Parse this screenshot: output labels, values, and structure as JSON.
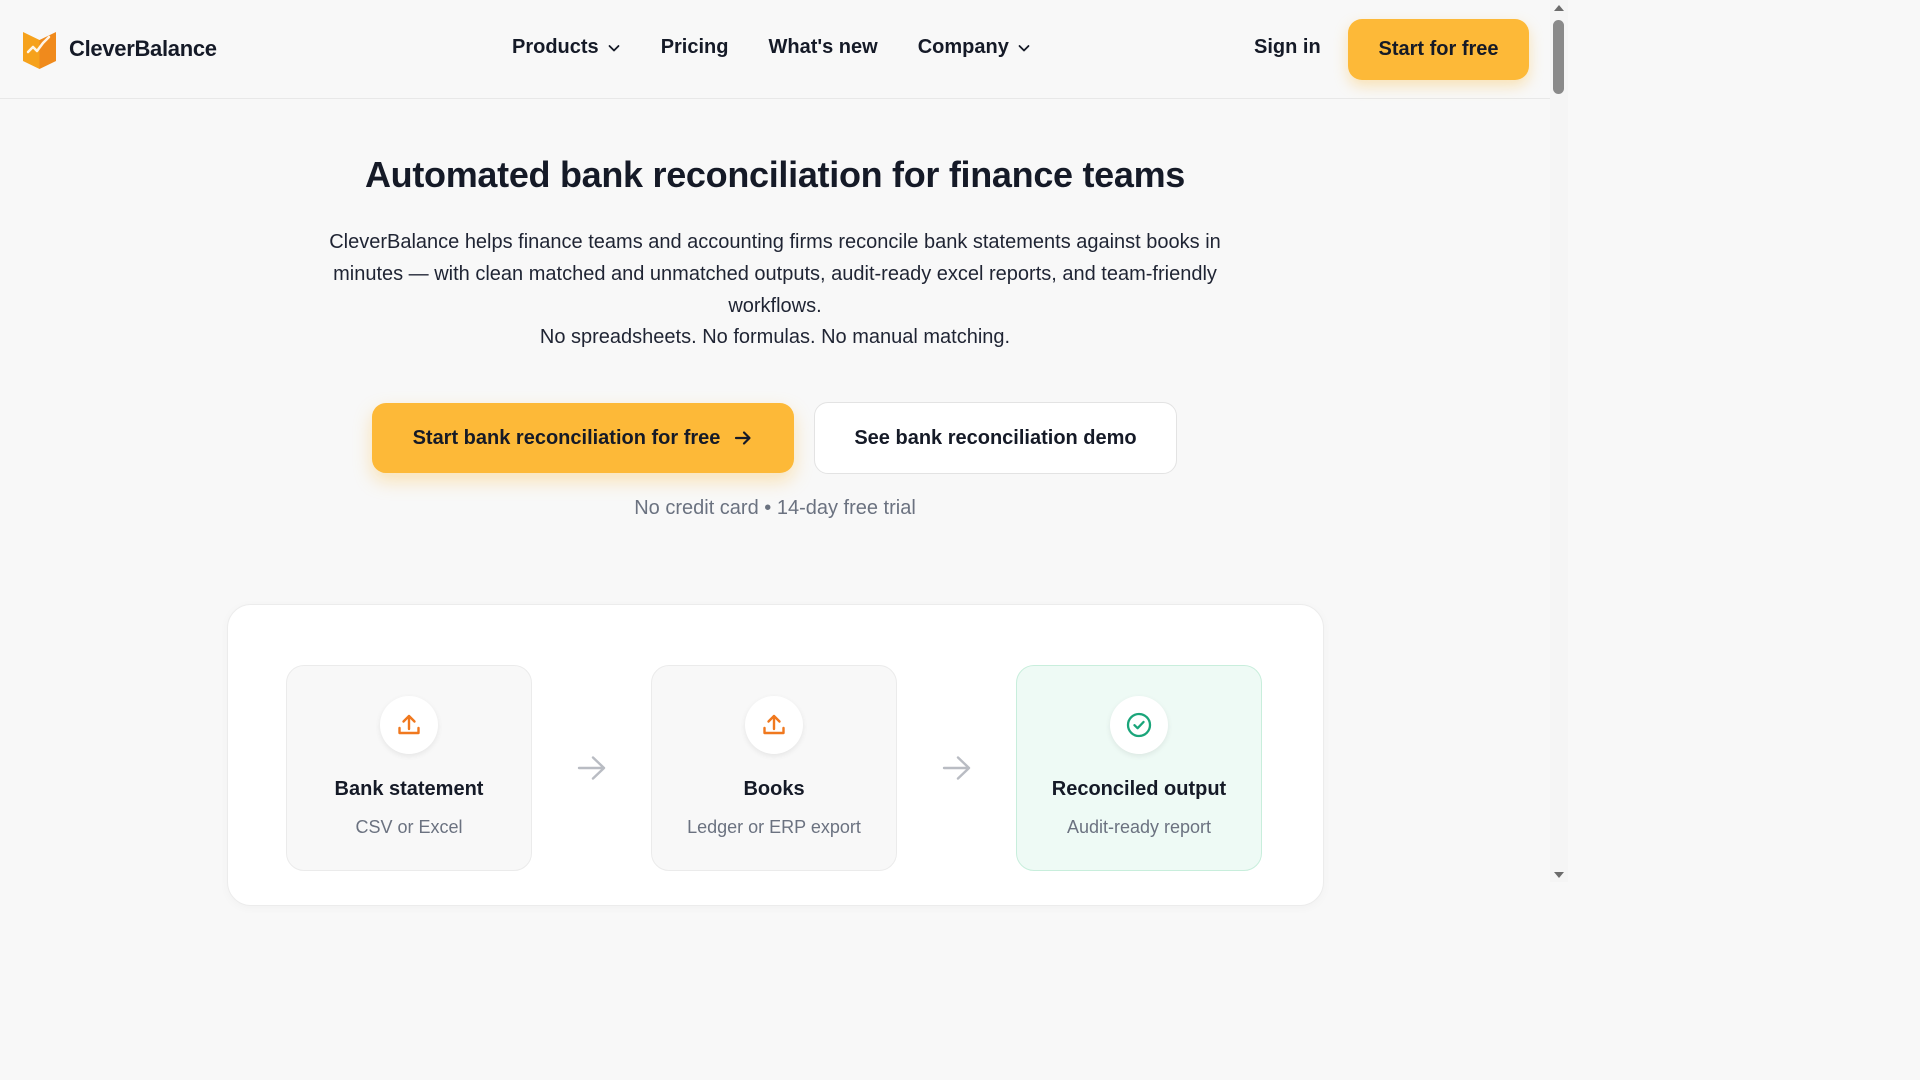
{
  "brand": {
    "name": "CleverBalance",
    "logo_icon": "cleverbalance-logo",
    "accent": "#fdb938",
    "logo_colors": [
      "#f6a21c",
      "#f08a1c"
    ]
  },
  "nav": {
    "items": [
      {
        "label": "Products",
        "has_dropdown": true
      },
      {
        "label": "Pricing",
        "has_dropdown": false
      },
      {
        "label": "What's new",
        "has_dropdown": false
      },
      {
        "label": "Company",
        "has_dropdown": true
      }
    ],
    "sign_in": "Sign in",
    "cta": "Start for free"
  },
  "hero": {
    "title": "Automated bank reconciliation for finance teams",
    "description": "CleverBalance helps finance teams and accounting firms reconcile bank statements against books in minutes — with clean matched and unmatched outputs, audit-ready excel reports, and team-friendly workflows.",
    "tagline": "No spreadsheets. No formulas. No manual matching.",
    "primary_cta": "Start bank reconciliation for free",
    "secondary_cta": "See bank reconciliation demo",
    "note": "No credit card • 14-day free trial"
  },
  "flow": {
    "steps": [
      {
        "title": "Bank statement",
        "subtitle": "CSV or Excel",
        "icon": "upload-icon",
        "color": "#f0781e"
      },
      {
        "title": "Books",
        "subtitle": "Ledger or ERP export",
        "icon": "upload-icon",
        "color": "#f0781e"
      },
      {
        "title": "Reconciled output",
        "subtitle": "Audit-ready report",
        "icon": "check-circle-icon",
        "color": "#1aa57a"
      }
    ]
  }
}
